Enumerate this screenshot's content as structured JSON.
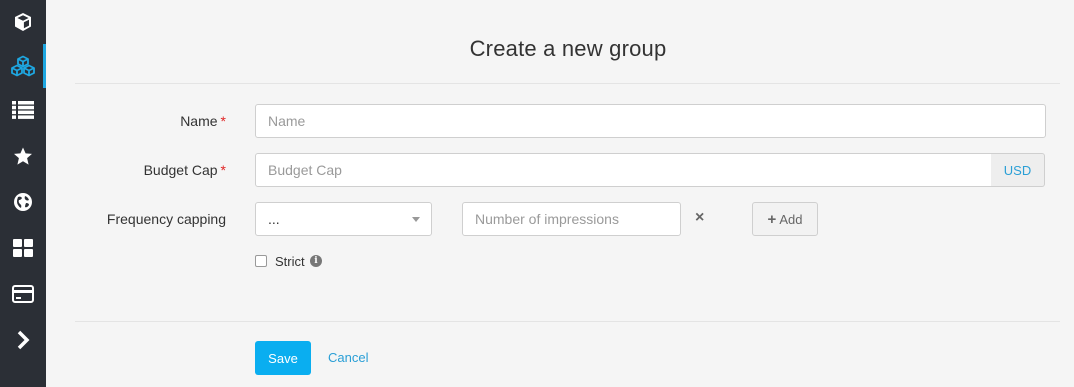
{
  "sidebar": {
    "items": [
      {
        "icon": "cube-icon",
        "active": false
      },
      {
        "icon": "cubes-icon",
        "active": true
      },
      {
        "icon": "list-icon",
        "active": false
      },
      {
        "icon": "star-icon",
        "active": false
      },
      {
        "icon": "globe-icon",
        "active": false
      },
      {
        "icon": "grid-icon",
        "active": false
      },
      {
        "icon": "credit-card-icon",
        "active": false
      },
      {
        "icon": "chevron-right-icon",
        "active": false
      }
    ],
    "accent_color": "#1ea7e1"
  },
  "page": {
    "title": "Create a new group"
  },
  "form": {
    "name": {
      "label": "Name",
      "required_mark": "*",
      "placeholder": "Name",
      "value": ""
    },
    "budget_cap": {
      "label": "Budget Cap",
      "required_mark": "*",
      "placeholder": "Budget Cap",
      "value": "",
      "currency": "USD"
    },
    "frequency_capping": {
      "label": "Frequency capping",
      "period_selected": "...",
      "impressions_placeholder": "Number of impressions",
      "remove_icon": "×",
      "add_icon": "+",
      "add_label": "Add"
    },
    "strict": {
      "label": "Strict",
      "checked": false,
      "info_icon": "i"
    }
  },
  "actions": {
    "save_label": "Save",
    "cancel_label": "Cancel",
    "primary_color": "#0aaef0"
  }
}
